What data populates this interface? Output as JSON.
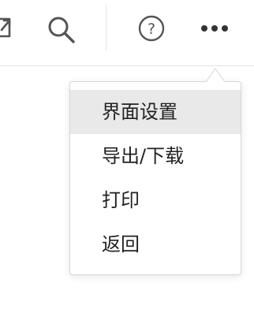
{
  "toolbar": {
    "icons": {
      "expand": "expand-icon",
      "search": "search-icon",
      "help": "help-icon",
      "more": "more-icon"
    },
    "help_glyph": "?"
  },
  "menu": {
    "items": [
      {
        "label": "界面设置",
        "active": true
      },
      {
        "label": "导出/下载",
        "active": false
      },
      {
        "label": "打印",
        "active": false
      },
      {
        "label": "返回",
        "active": false
      }
    ]
  },
  "colors": {
    "icon": "#555555",
    "menu_text": "#222222",
    "menu_active_bg": "#e9e9e9",
    "menu_border": "#d6d6d6"
  }
}
